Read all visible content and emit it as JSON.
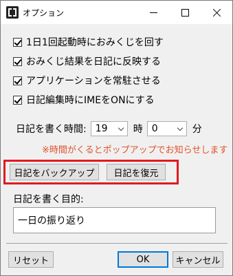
{
  "window": {
    "title": "オプション"
  },
  "options": [
    {
      "label": "1日1回起動時におみくじを回す",
      "checked": true
    },
    {
      "label": "おみくじ結果を日記に反映する",
      "checked": true
    },
    {
      "label": "アプリケーションを常駐させる",
      "checked": true
    },
    {
      "label": "日記編集時にIMEをONにする",
      "checked": true
    }
  ],
  "time": {
    "label": "日記を書く時間:",
    "hour_value": "19",
    "hour_unit": "時",
    "minute_value": "0",
    "minute_unit": "分",
    "note": "※時間がくるとポップアップでお知らせします"
  },
  "backup": {
    "backup_label": "日記をバックアップ",
    "restore_label": "日記を復元",
    "highlight_color": "#e01a22"
  },
  "purpose": {
    "label": "日記を書く目的:",
    "value": "一日の振り返り"
  },
  "footer": {
    "reset_label": "リセット",
    "ok_label": "OK",
    "cancel_label": "キャンセル"
  }
}
